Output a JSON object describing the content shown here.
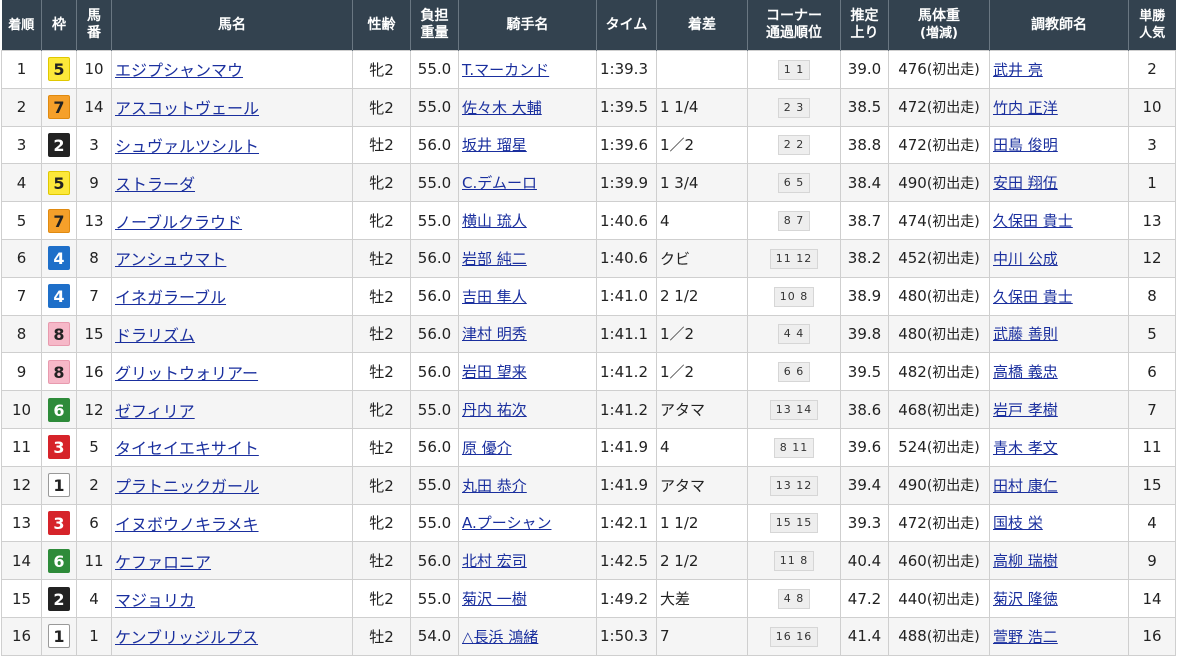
{
  "headers": {
    "rank": "着順",
    "waku": "枠",
    "umaban_1": "馬",
    "umaban_2": "番",
    "horse": "馬名",
    "sexage": "性齢",
    "weight_1": "負担",
    "weight_2": "重量",
    "jockey": "騎手名",
    "time": "タイム",
    "margin": "着差",
    "corner_1": "コーナー",
    "corner_2": "通過順位",
    "last3f_1": "推定",
    "last3f_2": "上り",
    "body_1": "馬体重",
    "body_2": "(増減)",
    "trainer": "調教師名",
    "pop_1": "単勝",
    "pop_2": "人気"
  },
  "waku_colors": {
    "1": {
      "bg": "#ffffff",
      "fg": "#222222",
      "border": "#999999"
    },
    "2": {
      "bg": "#222222",
      "fg": "#ffffff",
      "border": "#222222"
    },
    "3": {
      "bg": "#d6232a",
      "fg": "#ffffff",
      "border": "#d6232a"
    },
    "4": {
      "bg": "#1e6fc9",
      "fg": "#ffffff",
      "border": "#1e6fc9"
    },
    "5": {
      "bg": "#fce83a",
      "fg": "#222222",
      "border": "#e0c800"
    },
    "6": {
      "bg": "#2e8b3a",
      "fg": "#ffffff",
      "border": "#2e8b3a"
    },
    "7": {
      "bg": "#f5a02a",
      "fg": "#222222",
      "border": "#e08a10"
    },
    "8": {
      "bg": "#f6b8c8",
      "fg": "#222222",
      "border": "#e89aae"
    }
  },
  "rows": [
    {
      "rank": "1",
      "waku": "5",
      "umaban": "10",
      "horse": "エジプシャンマウ",
      "sexage": "牝2",
      "weight": "55.0",
      "jockey": "T.マーカンド",
      "time": "1:39.3",
      "margin": "",
      "corner": "1 1",
      "last3f": "39.0",
      "body_weight": "476",
      "body_diff": "(初出走)",
      "trainer": "武井 亮",
      "popularity": "2"
    },
    {
      "rank": "2",
      "waku": "7",
      "umaban": "14",
      "horse": "アスコットヴェール",
      "sexage": "牝2",
      "weight": "55.0",
      "jockey": "佐々木 大輔",
      "time": "1:39.5",
      "margin": "1 1/4",
      "corner": "2 3",
      "last3f": "38.5",
      "body_weight": "472",
      "body_diff": "(初出走)",
      "trainer": "竹内 正洋",
      "popularity": "10"
    },
    {
      "rank": "3",
      "waku": "2",
      "umaban": "3",
      "horse": "シュヴァルツシルト",
      "sexage": "牡2",
      "weight": "56.0",
      "jockey": "坂井 瑠星",
      "time": "1:39.6",
      "margin": "1／2",
      "corner": "2 2",
      "last3f": "38.8",
      "body_weight": "472",
      "body_diff": "(初出走)",
      "trainer": "田島 俊明",
      "popularity": "3"
    },
    {
      "rank": "4",
      "waku": "5",
      "umaban": "9",
      "horse": "ストラーダ",
      "sexage": "牝2",
      "weight": "55.0",
      "jockey": "C.デムーロ",
      "time": "1:39.9",
      "margin": "1 3/4",
      "corner": "6 5",
      "last3f": "38.4",
      "body_weight": "490",
      "body_diff": "(初出走)",
      "trainer": "安田 翔伍",
      "popularity": "1"
    },
    {
      "rank": "5",
      "waku": "7",
      "umaban": "13",
      "horse": "ノーブルクラウド",
      "sexage": "牝2",
      "weight": "55.0",
      "jockey": "横山 琉人",
      "time": "1:40.6",
      "margin": "4",
      "corner": "8 7",
      "last3f": "38.7",
      "body_weight": "474",
      "body_diff": "(初出走)",
      "trainer": "久保田 貴士",
      "popularity": "13"
    },
    {
      "rank": "6",
      "waku": "4",
      "umaban": "8",
      "horse": "アンシュウマト",
      "sexage": "牡2",
      "weight": "56.0",
      "jockey": "岩部 純二",
      "time": "1:40.6",
      "margin": "クビ",
      "corner": "11 12",
      "last3f": "38.2",
      "body_weight": "452",
      "body_diff": "(初出走)",
      "trainer": "中川 公成",
      "popularity": "12"
    },
    {
      "rank": "7",
      "waku": "4",
      "umaban": "7",
      "horse": "イネガラーブル",
      "sexage": "牡2",
      "weight": "56.0",
      "jockey": "吉田 隼人",
      "time": "1:41.0",
      "margin": "2 1/2",
      "corner": "10 8",
      "last3f": "38.9",
      "body_weight": "480",
      "body_diff": "(初出走)",
      "trainer": "久保田 貴士",
      "popularity": "8"
    },
    {
      "rank": "8",
      "waku": "8",
      "umaban": "15",
      "horse": "ドラリズム",
      "sexage": "牡2",
      "weight": "56.0",
      "jockey": "津村 明秀",
      "time": "1:41.1",
      "margin": "1／2",
      "corner": "4 4",
      "last3f": "39.8",
      "body_weight": "480",
      "body_diff": "(初出走)",
      "trainer": "武藤 善則",
      "popularity": "5"
    },
    {
      "rank": "9",
      "waku": "8",
      "umaban": "16",
      "horse": "グリットウォリアー",
      "sexage": "牡2",
      "weight": "56.0",
      "jockey": "岩田 望来",
      "time": "1:41.2",
      "margin": "1／2",
      "corner": "6 6",
      "last3f": "39.5",
      "body_weight": "482",
      "body_diff": "(初出走)",
      "trainer": "高橋 義忠",
      "popularity": "6"
    },
    {
      "rank": "10",
      "waku": "6",
      "umaban": "12",
      "horse": "ゼフィリア",
      "sexage": "牝2",
      "weight": "55.0",
      "jockey": "丹内 祐次",
      "time": "1:41.2",
      "margin": "アタマ",
      "corner": "13 14",
      "last3f": "38.6",
      "body_weight": "468",
      "body_diff": "(初出走)",
      "trainer": "岩戸 孝樹",
      "popularity": "7"
    },
    {
      "rank": "11",
      "waku": "3",
      "umaban": "5",
      "horse": "タイセイエキサイト",
      "sexage": "牡2",
      "weight": "56.0",
      "jockey": "原 優介",
      "time": "1:41.9",
      "margin": "4",
      "corner": "8 11",
      "last3f": "39.6",
      "body_weight": "524",
      "body_diff": "(初出走)",
      "trainer": "青木 孝文",
      "popularity": "11"
    },
    {
      "rank": "12",
      "waku": "1",
      "umaban": "2",
      "horse": "プラトニックガール",
      "sexage": "牝2",
      "weight": "55.0",
      "jockey": "丸田 恭介",
      "time": "1:41.9",
      "margin": "アタマ",
      "corner": "13 12",
      "last3f": "39.4",
      "body_weight": "490",
      "body_diff": "(初出走)",
      "trainer": "田村 康仁",
      "popularity": "15"
    },
    {
      "rank": "13",
      "waku": "3",
      "umaban": "6",
      "horse": "イヌボウノキラメキ",
      "sexage": "牝2",
      "weight": "55.0",
      "jockey": "A.プーシャン",
      "time": "1:42.1",
      "margin": "1 1/2",
      "corner": "15 15",
      "last3f": "39.3",
      "body_weight": "472",
      "body_diff": "(初出走)",
      "trainer": "国枝 栄",
      "popularity": "4"
    },
    {
      "rank": "14",
      "waku": "6",
      "umaban": "11",
      "horse": "ケファロニア",
      "sexage": "牡2",
      "weight": "56.0",
      "jockey": "北村 宏司",
      "time": "1:42.5",
      "margin": "2 1/2",
      "corner": "11 8",
      "last3f": "40.4",
      "body_weight": "460",
      "body_diff": "(初出走)",
      "trainer": "高柳 瑞樹",
      "popularity": "9"
    },
    {
      "rank": "15",
      "waku": "2",
      "umaban": "4",
      "horse": "マジョリカ",
      "sexage": "牝2",
      "weight": "55.0",
      "jockey": "菊沢 一樹",
      "time": "1:49.2",
      "margin": "大差",
      "corner": "4 8",
      "last3f": "47.2",
      "body_weight": "440",
      "body_diff": "(初出走)",
      "trainer": "菊沢 隆徳",
      "popularity": "14"
    },
    {
      "rank": "16",
      "waku": "1",
      "umaban": "1",
      "horse": "ケンブリッジルプス",
      "sexage": "牡2",
      "weight": "54.0",
      "jockey": "△長浜 鴻緒",
      "time": "1:50.3",
      "margin": "7",
      "corner": "16 16",
      "last3f": "41.4",
      "body_weight": "488",
      "body_diff": "(初出走)",
      "trainer": "萱野 浩二",
      "popularity": "16"
    }
  ]
}
